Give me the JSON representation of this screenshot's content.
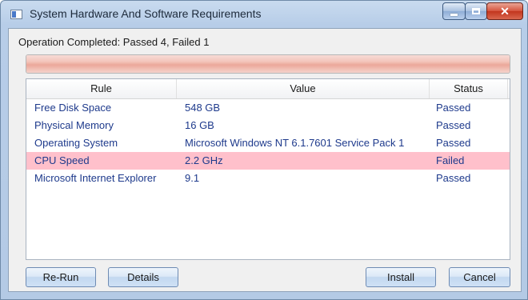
{
  "window": {
    "title": "System Hardware And Software Requirements",
    "controls": {
      "minimize": "minimize",
      "maximize": "maximize",
      "close": "✕"
    }
  },
  "status": {
    "text": "Operation Completed: Passed 4, Failed 1",
    "progress_fraction": 1.0
  },
  "table": {
    "columns": [
      "Rule",
      "Value",
      "Status"
    ],
    "rows": [
      {
        "rule": "Free Disk Space",
        "value": "548 GB",
        "status": "Passed"
      },
      {
        "rule": "Physical Memory",
        "value": "16 GB",
        "status": "Passed"
      },
      {
        "rule": "Operating System",
        "value": "Microsoft Windows NT 6.1.7601 Service Pack 1",
        "status": "Passed"
      },
      {
        "rule": "CPU Speed",
        "value": "2.2 GHz",
        "status": "Failed"
      },
      {
        "rule": "Microsoft Internet Explorer",
        "value": "9.1",
        "status": "Passed"
      }
    ],
    "failed_row_color": "#ffc0cb"
  },
  "buttons": {
    "rerun": "Re-Run",
    "details": "Details",
    "install": "Install",
    "cancel": "Cancel"
  }
}
